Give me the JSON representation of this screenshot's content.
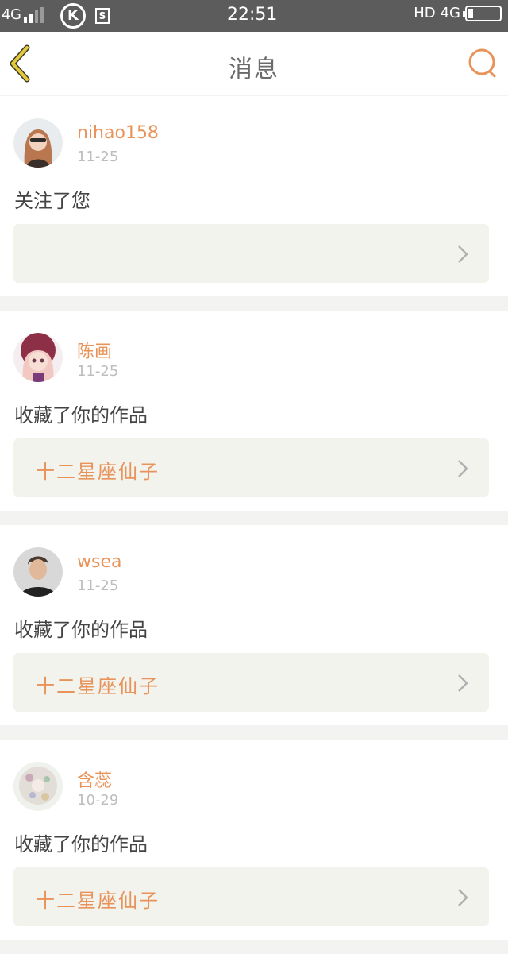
{
  "status_bar": {
    "network_left": "4G",
    "clock": "22:51",
    "hd": "HD",
    "network_right": "4G",
    "k_app_letter": "K",
    "s_app_letter": "S",
    "battery_level": 0.12
  },
  "nav": {
    "title": "消息",
    "back_icon": "chevron-left-icon",
    "search_icon": "search-icon",
    "accent_color": "#e8935a",
    "back_color": "#e6c93a"
  },
  "messages": [
    {
      "username": "nihao158",
      "date": "11-25",
      "action": "关注了您",
      "work_title": ""
    },
    {
      "username": "陈画",
      "date": "11-25",
      "action": "收藏了你的作品",
      "work_title": "十二星座仙子"
    },
    {
      "username": "wsea",
      "date": "11-25",
      "action": "收藏了你的作品",
      "work_title": "十二星座仙子"
    },
    {
      "username": "含蕊",
      "date": "10-29",
      "action": "收藏了你的作品",
      "work_title": "十二星座仙子"
    }
  ]
}
